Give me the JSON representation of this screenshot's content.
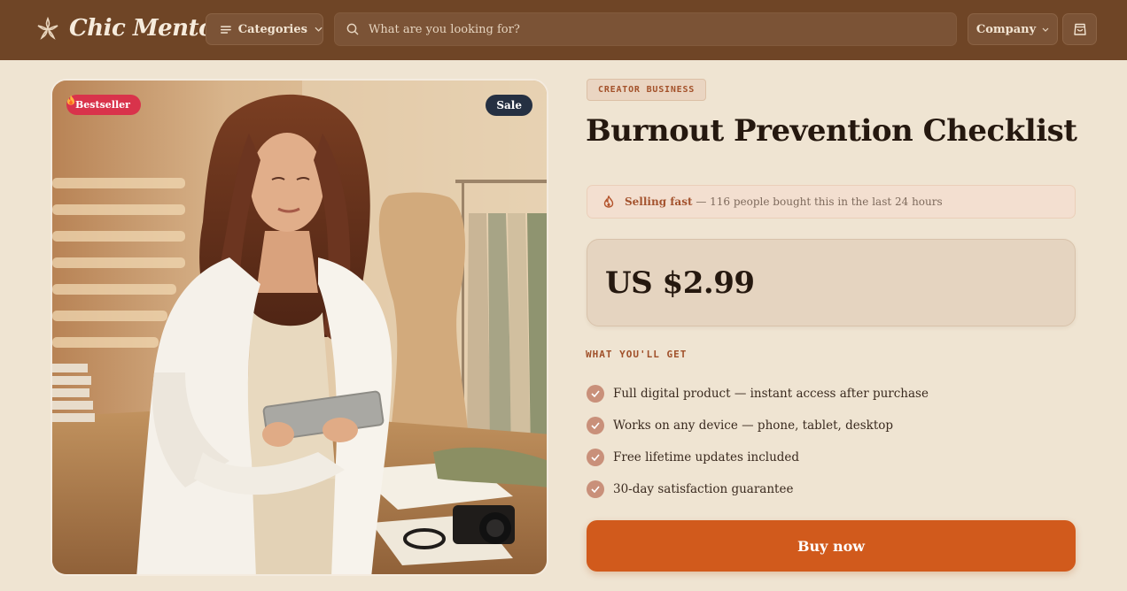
{
  "brand": {
    "name": "Chic Mentor",
    "logo_icon": "star-flower-logo-icon"
  },
  "header": {
    "categories_label": "Categories",
    "search_placeholder": "What are you looking for?",
    "company_label": "Company",
    "cart_icon": "shopping-bag-icon"
  },
  "product": {
    "badges": {
      "bestseller": "Bestseller",
      "sale": "Sale"
    },
    "category": "CREATOR BUSINESS",
    "title": "Burnout Prevention Checklist",
    "alert": {
      "strong": "Selling fast",
      "rest": " — 116 people bought this in the last 24 hours"
    },
    "price": "US $2.99",
    "features_heading": "WHAT YOU'LL GET",
    "features": [
      "Full digital product — instant access after purchase",
      "Works on any device — phone, tablet, desktop",
      "Free lifetime updates included",
      "30-day satisfaction guarantee"
    ],
    "buy_label": "Buy now"
  },
  "colors": {
    "header_bg": "#6f4526",
    "page_bg": "#efe4d2",
    "accent": "#d15a1c",
    "bestseller_badge": "#d9334b",
    "sale_badge": "#253042"
  }
}
